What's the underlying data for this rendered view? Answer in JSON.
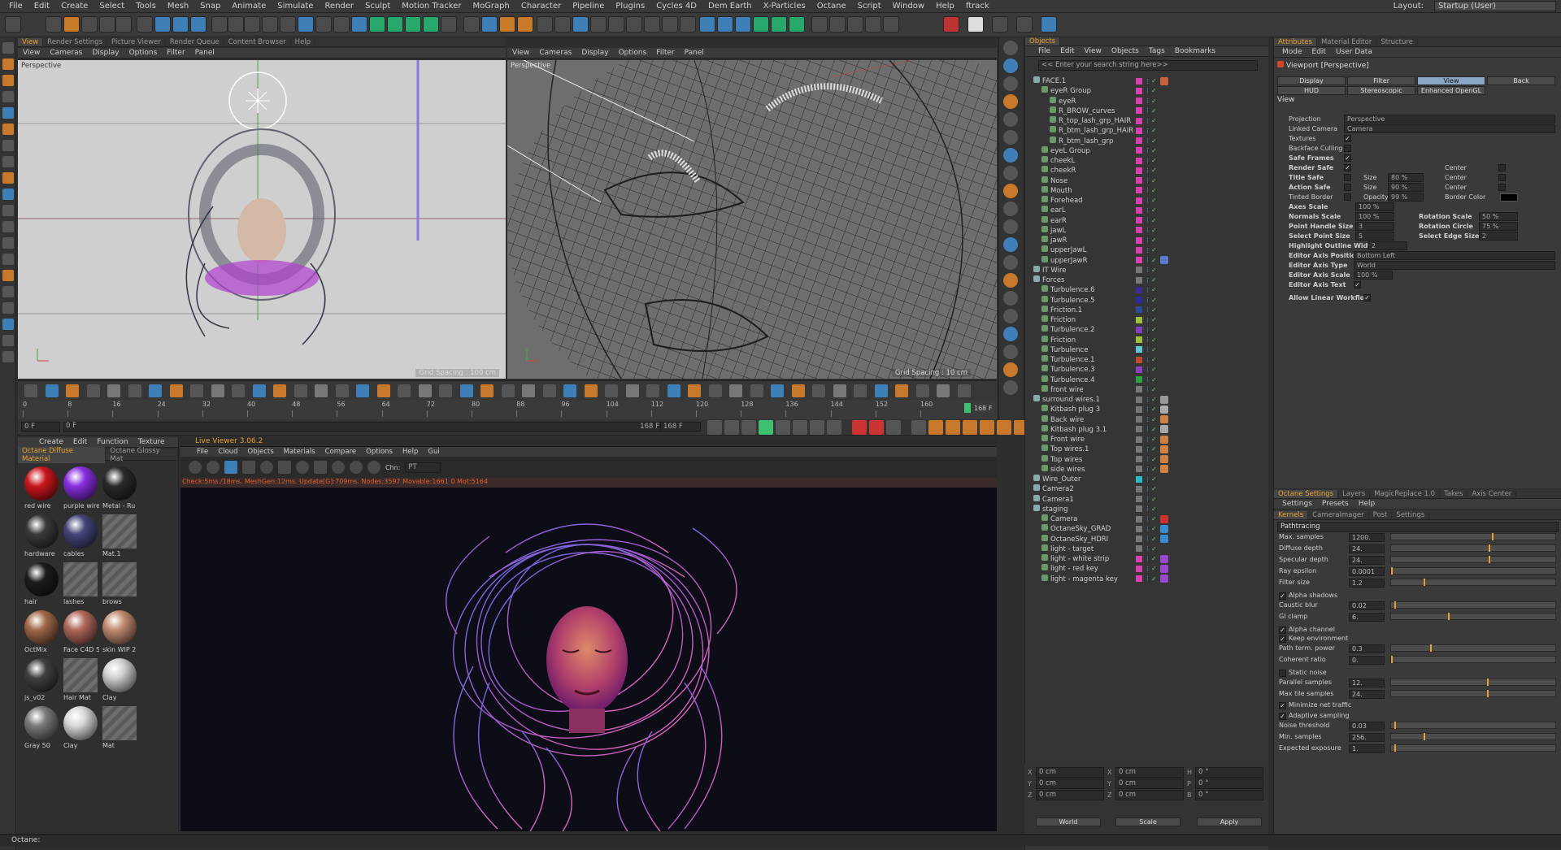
{
  "menubar": {
    "items": [
      "File",
      "Edit",
      "Create",
      "Select",
      "Tools",
      "Mesh",
      "Snap",
      "Animate",
      "Simulate",
      "Render",
      "Sculpt",
      "Motion Tracker",
      "MoGraph",
      "Character",
      "Pipeline",
      "Plugins",
      "Cycles 4D",
      "Dem Earth",
      "X-Particles",
      "Octane",
      "Script",
      "Window",
      "Help",
      "ftrack"
    ],
    "layout_label": "Layout:",
    "layout_value": "Startup (User)"
  },
  "tabs_top": [
    "View",
    "Render Settings",
    "Picture Viewer",
    "Render Queue",
    "Content Browser",
    "Help"
  ],
  "viewport1": {
    "menu": [
      "View",
      "Cameras",
      "Display",
      "Options",
      "Filter",
      "Panel"
    ],
    "label": "Perspective",
    "grid_spacing": "Grid Spacing : 100 cm"
  },
  "viewport2": {
    "menu": [
      "View",
      "Cameras",
      "Display",
      "Options",
      "Filter",
      "Panel"
    ],
    "label": "Perspective",
    "grid_spacing": "Grid Spacing : 10 cm"
  },
  "timeline": {
    "ticks": [
      "0",
      "8",
      "16",
      "24",
      "32",
      "40",
      "48",
      "56",
      "64",
      "72",
      "80",
      "88",
      "96",
      "104",
      "112",
      "120",
      "128",
      "136",
      "144",
      "152",
      "160"
    ],
    "end_frame": "168 F",
    "current_frame": "0 F",
    "start_field": "0 F",
    "max_field": "168 F",
    "max_field2": "168 F"
  },
  "material_manager": {
    "menu": [
      "Create",
      "Edit",
      "Function",
      "Texture"
    ],
    "tabs": [
      "Octane Diffuse Material",
      "Octane Glossy Mat"
    ],
    "materials": [
      {
        "name": "red wire",
        "color": "#c8161c"
      },
      {
        "name": "purple wire",
        "color": "#8a2ee0"
      },
      {
        "name": "Metal - Ru",
        "color": "#2a2a2a"
      },
      {
        "name": "hardware",
        "color": "#3a3a3a"
      },
      {
        "name": "cables",
        "color": "#45457a"
      },
      {
        "name": "Mat.1",
        "color": "hatch"
      },
      {
        "name": "hair",
        "color": "#1c1c1c"
      },
      {
        "name": "lashes",
        "color": "hatch"
      },
      {
        "name": "brows",
        "color": "hatch"
      },
      {
        "name": "OctMix",
        "color": "#a06848"
      },
      {
        "name": "Face C4D S",
        "color": "#b0675a"
      },
      {
        "name": "skin WIP 2",
        "color": "#c08a70"
      },
      {
        "name": "js_v02",
        "color": "#404040"
      },
      {
        "name": "Hair Mat",
        "color": "hatch"
      },
      {
        "name": "Clay",
        "color": "#d0d0d0"
      },
      {
        "name": "Gray 50",
        "color": "#7a7a7a"
      },
      {
        "name": "Clay",
        "color": "#d8d8d8"
      },
      {
        "name": "Mat",
        "color": "hatch"
      }
    ]
  },
  "live_viewer": {
    "title": "Live Viewer 3.06.2",
    "menu": [
      "File",
      "Cloud",
      "Objects",
      "Materials",
      "Compare",
      "Options",
      "Help",
      "Gui"
    ],
    "channel_label": "Chn:",
    "channel_value": "PT",
    "status": "Check:5ms./18ms. MeshGen:12ms. Update[G]:709ms. Nodes:3597 Movable:1661 0 Mot:5164"
  },
  "object_manager": {
    "title": "Objects",
    "menu": [
      "File",
      "Edit",
      "View",
      "Objects",
      "Tags",
      "Bookmarks"
    ],
    "search_placeholder": "<< Enter your search string here>>",
    "objects": [
      {
        "name": "FACE.1",
        "depth": 0,
        "color": "#d93fb0",
        "tag": "#c86040"
      },
      {
        "name": "eyeR Group",
        "depth": 1,
        "color": "#d93fb0",
        "tag": ""
      },
      {
        "name": "eyeR",
        "depth": 2,
        "color": "#d93fb0",
        "tag": ""
      },
      {
        "name": "R_BROW_curves",
        "depth": 2,
        "color": "#d93fb0",
        "tag": ""
      },
      {
        "name": "R_top_lash_grp_HAIR",
        "depth": 2,
        "color": "#d93fb0",
        "tag": ""
      },
      {
        "name": "R_btm_lash_grp_HAIR",
        "depth": 2,
        "color": "#d93fb0",
        "tag": ""
      },
      {
        "name": "R_btm_lash_grp",
        "depth": 2,
        "color": "#d93fb0",
        "tag": ""
      },
      {
        "name": "eyeL Group",
        "depth": 1,
        "color": "#d93fb0",
        "tag": ""
      },
      {
        "name": "cheekL",
        "depth": 1,
        "color": "#d93fb0",
        "tag": ""
      },
      {
        "name": "cheekR",
        "depth": 1,
        "color": "#d93fb0",
        "tag": ""
      },
      {
        "name": "Nose",
        "depth": 1,
        "color": "#d93fb0",
        "tag": ""
      },
      {
        "name": "Mouth",
        "depth": 1,
        "color": "#d93fb0",
        "tag": ""
      },
      {
        "name": "Forehead",
        "depth": 1,
        "color": "#d93fb0",
        "tag": ""
      },
      {
        "name": "earL",
        "depth": 1,
        "color": "#d93fb0",
        "tag": ""
      },
      {
        "name": "earR",
        "depth": 1,
        "color": "#d93fb0",
        "tag": ""
      },
      {
        "name": "jawL",
        "depth": 1,
        "color": "#d93fb0",
        "tag": ""
      },
      {
        "name": "jawR",
        "depth": 1,
        "color": "#d93fb0",
        "tag": ""
      },
      {
        "name": "upperJawL",
        "depth": 1,
        "color": "#d93fb0",
        "tag": ""
      },
      {
        "name": "upperJawR",
        "depth": 1,
        "color": "#d93fb0",
        "tag": "#5a7ad0"
      },
      {
        "name": "IT Wire",
        "depth": 0,
        "color": "#777777",
        "tag": ""
      },
      {
        "name": "Forces",
        "depth": 0,
        "color": "#777777",
        "tag": ""
      },
      {
        "name": "Turbulence.6",
        "depth": 1,
        "color": "#3a2a9a",
        "tag": ""
      },
      {
        "name": "Turbulence.5",
        "depth": 1,
        "color": "#2a2a9a",
        "tag": ""
      },
      {
        "name": "Friction.1",
        "depth": 1,
        "color": "#2a4a9a",
        "tag": ""
      },
      {
        "name": "Friction",
        "depth": 1,
        "color": "#a0c040",
        "tag": ""
      },
      {
        "name": "Turbulence.2",
        "depth": 1,
        "color": "#8040c0",
        "tag": ""
      },
      {
        "name": "Friction",
        "depth": 1,
        "color": "#a0c040",
        "tag": ""
      },
      {
        "name": "Turbulence",
        "depth": 1,
        "color": "#60c8d0",
        "tag": ""
      },
      {
        "name": "Turbulence.1",
        "depth": 1,
        "color": "#c04a30",
        "tag": ""
      },
      {
        "name": "Turbulence.3",
        "depth": 1,
        "color": "#8a40c0",
        "tag": ""
      },
      {
        "name": "Turbulence.4",
        "depth": 1,
        "color": "#2aa040",
        "tag": ""
      },
      {
        "name": "front wire",
        "depth": 1,
        "color": "#777777",
        "tag": ""
      },
      {
        "name": "surround wires.1",
        "depth": 0,
        "color": "#777777",
        "tag": "#999999"
      },
      {
        "name": "Kitbash plug 3",
        "depth": 1,
        "color": "#777777",
        "tag": "#aaaaaa"
      },
      {
        "name": "Back wire",
        "depth": 1,
        "color": "#777777",
        "tag": "#d08040"
      },
      {
        "name": "Kitbash plug 3.1",
        "depth": 1,
        "color": "#777777",
        "tag": "#aaaaaa"
      },
      {
        "name": "Front wire",
        "depth": 1,
        "color": "#777777",
        "tag": "#d08040"
      },
      {
        "name": "Top wires.1",
        "depth": 1,
        "color": "#777777",
        "tag": "#d08040"
      },
      {
        "name": "Top wires",
        "depth": 1,
        "color": "#777777",
        "tag": "#d08040"
      },
      {
        "name": "side wires",
        "depth": 1,
        "color": "#777777",
        "tag": "#d08040"
      },
      {
        "name": "Wire_Outer",
        "depth": 0,
        "color": "#30b8c0",
        "tag": ""
      },
      {
        "name": "Camera2",
        "depth": 0,
        "color": "#777777",
        "tag": ""
      },
      {
        "name": "Camera1",
        "depth": 0,
        "color": "#777777",
        "tag": ""
      },
      {
        "name": "staging",
        "depth": 0,
        "color": "#777777",
        "tag": ""
      },
      {
        "name": "Camera",
        "depth": 1,
        "color": "#777777",
        "tag": "#d03030"
      },
      {
        "name": "OctaneSky_GRAD",
        "depth": 1,
        "color": "#777777",
        "tag": "#3a8ad0"
      },
      {
        "name": "OctaneSky_HDRI",
        "depth": 1,
        "color": "#777777",
        "tag": "#3a8ad0"
      },
      {
        "name": "light - target",
        "depth": 1,
        "color": "#777777",
        "tag": ""
      },
      {
        "name": "light - white strip",
        "depth": 1,
        "color": "#d93fb0",
        "tag": "#9a4ad0"
      },
      {
        "name": "light - red key",
        "depth": 1,
        "color": "#d93fb0",
        "tag": "#9a4ad0"
      },
      {
        "name": "light - magenta key",
        "depth": 1,
        "color": "#d93fb0",
        "tag": "#9a4ad0"
      }
    ]
  },
  "coordinates": {
    "rows": [
      {
        "a": "X",
        "av": "0 cm",
        "b": "X",
        "bv": "0 cm",
        "c": "H",
        "cv": "0 °"
      },
      {
        "a": "Y",
        "av": "0 cm",
        "b": "Y",
        "bv": "0 cm",
        "c": "P",
        "cv": "0 °"
      },
      {
        "a": "Z",
        "av": "0 cm",
        "b": "Z",
        "bv": "0 cm",
        "c": "B",
        "cv": "0 °"
      }
    ],
    "world": "World",
    "scale": "Scale",
    "apply": "Apply"
  },
  "attributes": {
    "tabs": [
      "Attributes",
      "Material Editor",
      "Structure"
    ],
    "menu": [
      "Mode",
      "Edit",
      "User Data"
    ],
    "title": "Viewport [Perspective]",
    "buttons_row1": [
      "Display",
      "Filter",
      "View",
      "Back"
    ],
    "buttons_row2": [
      "HUD",
      "Stereoscopic",
      "Enhanced OpenGL"
    ],
    "section": "View",
    "projection_label": "Projection",
    "projection_value": "Perspective",
    "linked_camera_label": "Linked Camera",
    "linked_camera_value": "Camera",
    "textures": "Textures",
    "backface": "Backface Culling",
    "safe_frames": "Safe Frames",
    "render_safe": "Render Safe",
    "title_safe": "Title Safe",
    "action_safe": "Action Safe",
    "tinted_border": "Tinted Border",
    "center": "Center",
    "size": "Size",
    "size_val1": "80 %",
    "size_val2": "90 %",
    "opacity_label": "Opacity",
    "opacity_value": "99 %",
    "border_color": "Border Color",
    "axes_scale_label": "Axes Scale",
    "axes_scale_value": "100 %",
    "normals_scale_label": "Normals Scale",
    "normals_scale_value": "100 %",
    "rotation_scale_label": "Rotation Scale",
    "rotation_scale_value": "50 %",
    "point_handle_label": "Point Handle Size",
    "point_handle_value": "3",
    "rotation_circle_label": "Rotation Circle",
    "rotation_circle_value": "75 %",
    "select_point_label": "Select Point Size",
    "select_point_value": "5",
    "select_edge_label": "Select Edge Size",
    "select_edge_value": "2",
    "highlight_label": "Highlight Outline Width",
    "highlight_value": "2",
    "axis_pos_label": "Editor Axis Position",
    "axis_pos_value": "Bottom Left",
    "axis_type_label": "Editor Axis Type",
    "axis_type_value": "World",
    "axis_scale_label": "Editor Axis Scale",
    "axis_scale_value": "100 %",
    "axis_text_label": "Editor Axis Text",
    "linear_workflow": "Allow Linear Workflow"
  },
  "octane": {
    "tabs": [
      "Octane Settings",
      "Layers",
      "MagicReplace 1.0",
      "Takes",
      "Axis Center"
    ],
    "menu": [
      "Settings",
      "Presets",
      "Help"
    ],
    "subtabs": [
      "Kernels",
      "CameraImager",
      "Post",
      "Settings"
    ],
    "kernel": "Pathtracing",
    "params": [
      {
        "label": "Max. samples",
        "value": "1200.",
        "level": 0.62
      },
      {
        "label": "Diffuse depth",
        "value": "24.",
        "level": 0.6
      },
      {
        "label": "Specular depth",
        "value": "24.",
        "level": 0.6
      },
      {
        "label": "Ray epsilon",
        "value": "0.0001",
        "level": 0.0
      },
      {
        "label": "Filter size",
        "value": "1.2",
        "level": 0.2
      }
    ],
    "alpha_shadows": "Alpha shadows",
    "params2": [
      {
        "label": "Caustic blur",
        "value": "0.02",
        "level": 0.02
      },
      {
        "label": "GI clamp",
        "value": "6.",
        "level": 0.35
      }
    ],
    "alpha_channel": "Alpha channel",
    "keep_env": "Keep environment",
    "params3": [
      {
        "label": "Path term. power",
        "value": "0.3",
        "level": 0.24
      },
      {
        "label": "Coherent ratio",
        "value": "0.",
        "level": 0.0
      }
    ],
    "static_noise": "Static noise",
    "params4": [
      {
        "label": "Parallel samples",
        "value": "12.",
        "level": 0.59
      },
      {
        "label": "Max tile samples",
        "value": "24.",
        "level": 0.59
      }
    ],
    "min_net": "Minimize net traffic",
    "adaptive": "Adaptive sampling",
    "params5": [
      {
        "label": "Noise threshold",
        "value": "0.03",
        "level": 0.02
      },
      {
        "label": "Min. samples",
        "value": "256.",
        "level": 0.2
      },
      {
        "label": "Expected exposure",
        "value": "1.",
        "level": 0.02
      }
    ]
  },
  "status_bar": "Octane:"
}
